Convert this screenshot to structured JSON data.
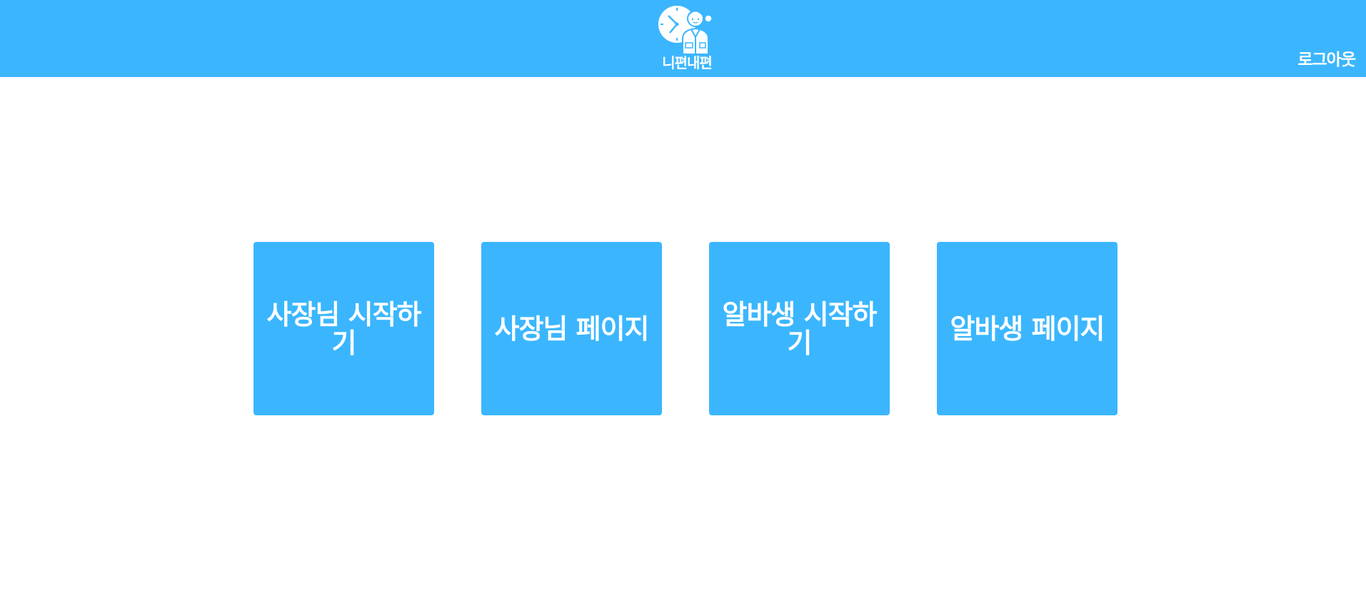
{
  "header": {
    "logo_text": "니편내편",
    "logout_label": "로그아웃"
  },
  "cards": [
    {
      "label": "사장님 시작하기"
    },
    {
      "label": "사장님 페이지"
    },
    {
      "label": "알바생 시작하기"
    },
    {
      "label": "알바생 페이지"
    }
  ],
  "colors": {
    "brand": "#3bb6fe",
    "text_on_brand": "#ffffff",
    "background": "#ffffff"
  }
}
